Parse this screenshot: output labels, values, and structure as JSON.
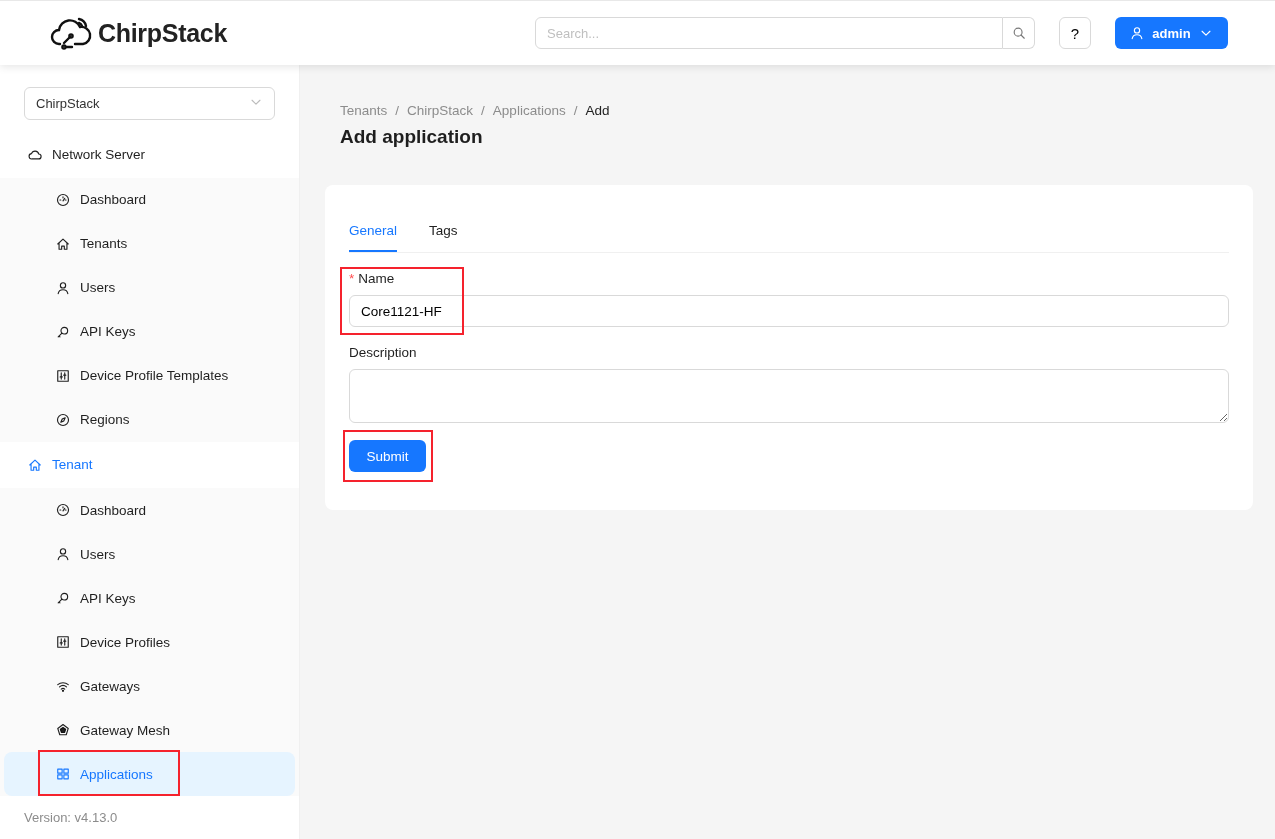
{
  "header": {
    "logo_text": "ChirpStack",
    "search": {
      "placeholder": "Search..."
    },
    "help_label": "?",
    "user_label": "admin"
  },
  "sidebar": {
    "tenant_select": "ChirpStack",
    "groups": [
      {
        "label": "Network Server",
        "active": false,
        "items": [
          {
            "label": "Dashboard",
            "selected": false,
            "highlighted": false
          },
          {
            "label": "Tenants",
            "selected": false,
            "highlighted": false
          },
          {
            "label": "Users",
            "selected": false,
            "highlighted": false
          },
          {
            "label": "API Keys",
            "selected": false,
            "highlighted": false
          },
          {
            "label": "Device Profile Templates",
            "selected": false,
            "highlighted": false
          },
          {
            "label": "Regions",
            "selected": false,
            "highlighted": false
          }
        ]
      },
      {
        "label": "Tenant",
        "active": true,
        "items": [
          {
            "label": "Dashboard",
            "selected": false,
            "highlighted": false
          },
          {
            "label": "Users",
            "selected": false,
            "highlighted": false
          },
          {
            "label": "API Keys",
            "selected": false,
            "highlighted": false
          },
          {
            "label": "Device Profiles",
            "selected": false,
            "highlighted": false
          },
          {
            "label": "Gateways",
            "selected": false,
            "highlighted": false
          },
          {
            "label": "Gateway Mesh",
            "selected": false,
            "highlighted": false
          },
          {
            "label": "Applications",
            "selected": true,
            "highlighted": true
          }
        ]
      }
    ],
    "version": "Version: v4.13.0"
  },
  "breadcrumb": {
    "separator": "/",
    "items": [
      "Tenants",
      "ChirpStack",
      "Applications",
      "Add"
    ]
  },
  "title": "Add application",
  "tabs": [
    {
      "label": "General",
      "selected": true
    },
    {
      "label": "Tags",
      "selected": false
    }
  ],
  "fields": [
    {
      "kind": "input",
      "label": "Name",
      "required_mark": "*",
      "value": "Core1121-HF",
      "highlighted": true
    },
    {
      "kind": "textarea",
      "label": "Description",
      "highlighted": false
    }
  ],
  "submit": {
    "label": "Submit",
    "highlighted": true
  }
}
